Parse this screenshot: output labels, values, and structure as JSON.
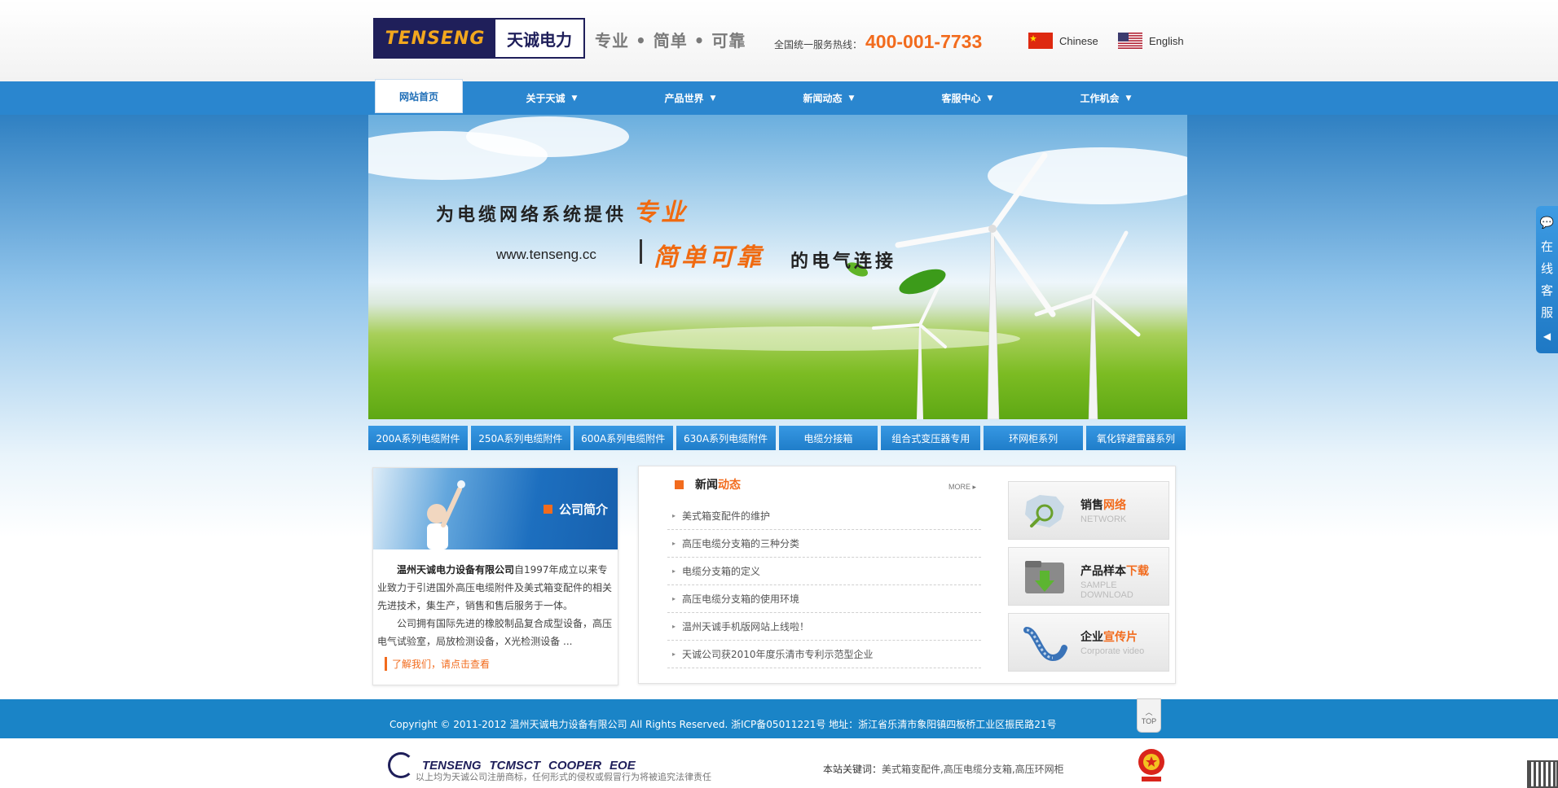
{
  "header": {
    "logo_en": "TENSENG",
    "logo_cn": "天诚电力",
    "slogan": "专业 • 简单 • 可靠",
    "hotline_label": "全国统一服务热线：",
    "hotline_number": "400-001-7733",
    "lang_cn": "Chinese",
    "lang_en": "English"
  },
  "nav": {
    "home": "网站首页",
    "items": [
      "关于天诚",
      "产品世界",
      "新闻动态",
      "客服中心",
      "工作机会"
    ]
  },
  "banner": {
    "line1": "为电缆网络系统提供",
    "accent1": "专业",
    "url": "www.tenseng.cc",
    "accent2": "简单可靠",
    "line2": "的电气连接"
  },
  "categories": [
    "200A系列电缆附件",
    "250A系列电缆附件",
    "600A系列电缆附件",
    "630A系列电缆附件",
    "电缆分接箱",
    "组合式变压器专用",
    "环网柜系列",
    "氧化锌避雷器系列"
  ],
  "about": {
    "title": "公司简介",
    "company": "温州天诚电力设备有限公司",
    "para1_rest": "自1997年成立以来专业致力于引进国外高压电缆附件及美式箱变配件的相关先进技术，集生产，销售和售后服务于一体。",
    "para2": "公司拥有国际先进的橡胶制品复合成型设备，高压电气试验室，局放检测设备，X光检测设备 ...",
    "more": "了解我们，请点击查看"
  },
  "news": {
    "title_a": "新闻",
    "title_b": "动态",
    "more": "MORE ▸",
    "items": [
      "美式箱变配件的维护",
      "高压电缆分支箱的三种分类",
      "电缆分支箱的定义",
      "高压电缆分支箱的使用环境",
      "温州天诚手机版网站上线啦！",
      "天诚公司获2010年度乐清市专利示范型企业"
    ]
  },
  "cards": [
    {
      "title_a": "销售",
      "title_b": "网络",
      "sub": "NETWORK"
    },
    {
      "title_a": "产品样本",
      "title_b": "下载",
      "sub": "SAMPLE DOWNLOAD"
    },
    {
      "title_a": "企业",
      "title_b": "宣传片",
      "sub": "Corporate video"
    }
  ],
  "footer": {
    "copyright": "Copyright © 2011-2012 温州天诚电力设备有限公司 All Rights Reserved.  浙ICP备05011221号  地址：浙江省乐清市象阳镇四板桥工业区振民路21号",
    "top": "TOP",
    "brands": [
      "TENSENG",
      "TCMSCT",
      "COOPER",
      "EOE"
    ],
    "brand_note": "以上均为天诚公司注册商标，任何形式的侵权或假冒行为将被追究法律责任",
    "keywords_label": "本站关键词：",
    "keywords": "美式箱变配件,高压电缆分支箱,高压环网柜"
  },
  "service": {
    "chars": [
      "在",
      "线",
      "客",
      "服"
    ]
  },
  "colors": {
    "brand_blue": "#1a84c7",
    "accent_orange": "#f26b1d",
    "logo_navy": "#1f1f5a"
  }
}
